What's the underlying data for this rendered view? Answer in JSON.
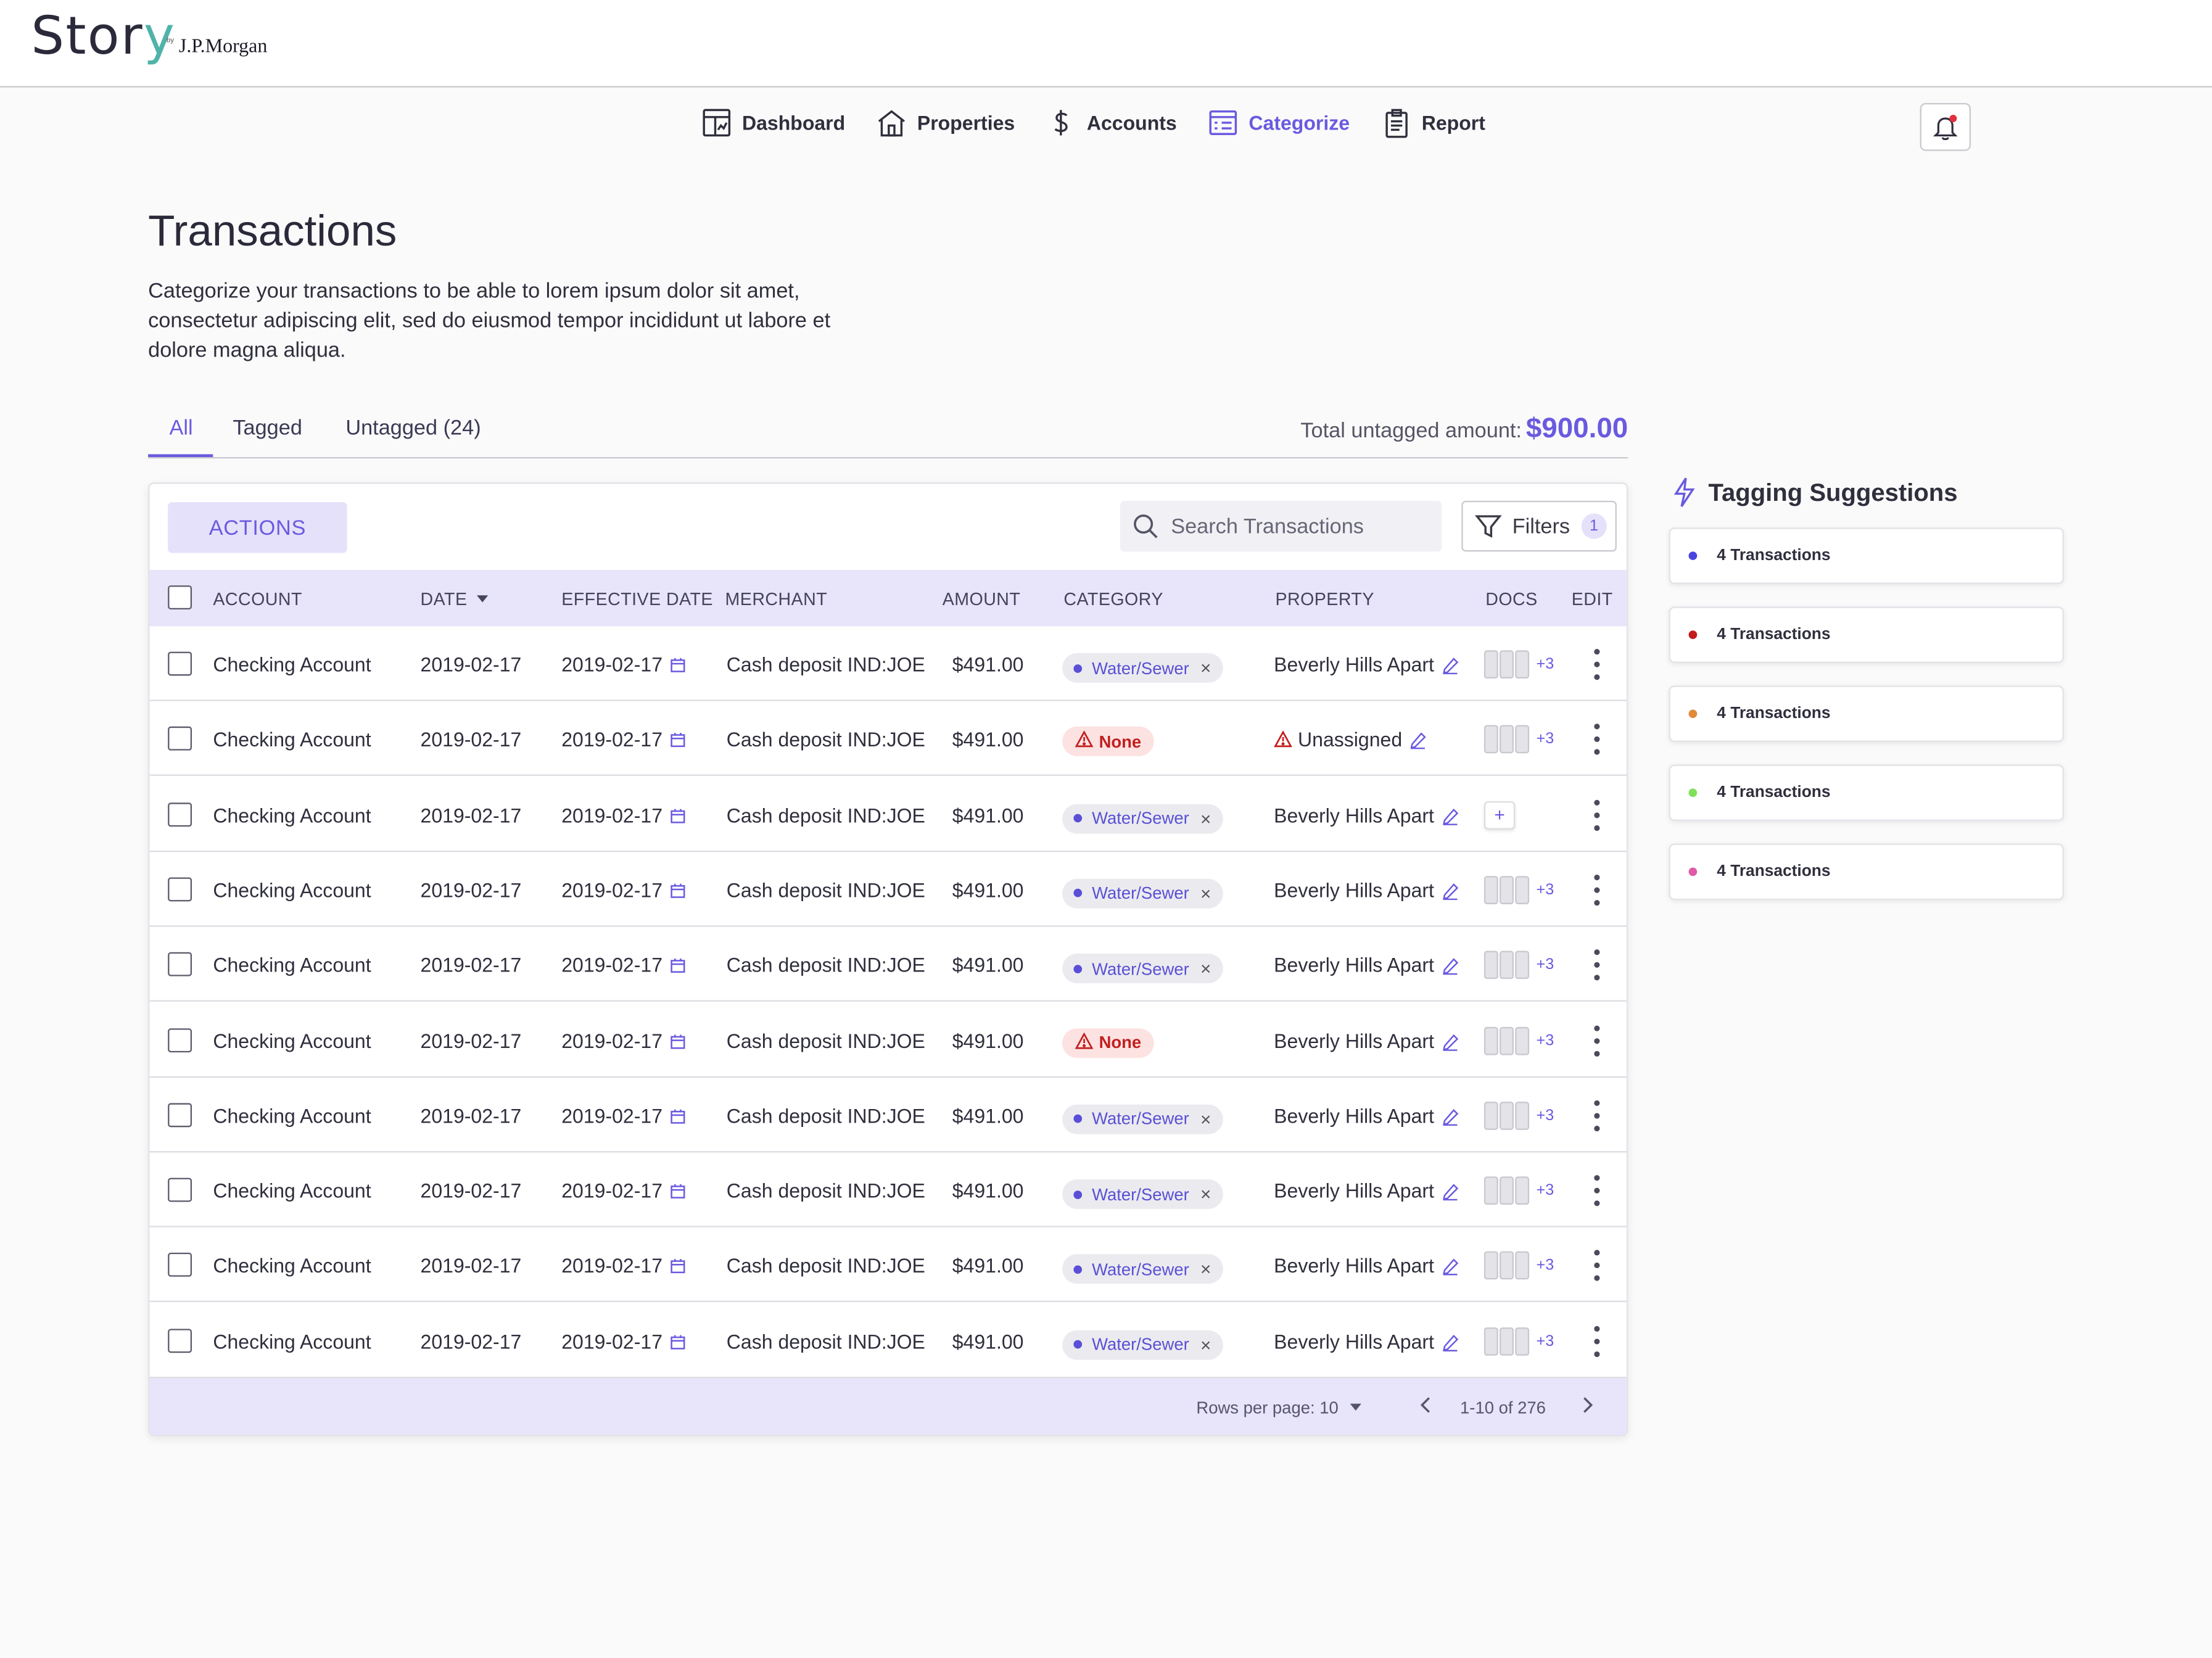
{
  "brand": {
    "name_main": "Stor",
    "name_y": "y",
    "by": "by",
    "partner": "J.P.Morgan"
  },
  "nav": [
    {
      "label": "Dashboard",
      "icon": "dashboard-icon"
    },
    {
      "label": "Properties",
      "icon": "house-icon"
    },
    {
      "label": "Accounts",
      "icon": "dollar-icon"
    },
    {
      "label": "Categorize",
      "icon": "categorize-icon",
      "active": true
    },
    {
      "label": "Report",
      "icon": "clipboard-icon"
    }
  ],
  "page": {
    "title": "Transactions",
    "description": "Categorize your transactions to be able to lorem ipsum dolor sit amet, consectetur adipiscing elit, sed do eiusmod tempor incididunt ut labore et dolore magna aliqua."
  },
  "tabs": {
    "all": "All",
    "tagged": "Tagged",
    "untagged": "Untagged (24)"
  },
  "total": {
    "label": "Total untagged amount:",
    "amount": "$900.00"
  },
  "toolbar": {
    "actions_label": "ACTIONS",
    "search_placeholder": "Search Transactions",
    "filters_label": "Filters",
    "filters_count": "1"
  },
  "columns": {
    "account": "ACCOUNT",
    "date": "DATE",
    "effective_date": "EFFECTIVE DATE",
    "merchant": "MERCHANT",
    "amount": "AMOUNT",
    "category": "CATEGORY",
    "property": "PROPERTY",
    "docs": "DOCS",
    "edit": "EDIT"
  },
  "rows": [
    {
      "account": "Checking Account",
      "date": "2019-02-17",
      "effective_date": "2019-02-17",
      "merchant": "Cash deposit IND:JOE",
      "amount": "$491.00",
      "category": "Water/Sewer",
      "category_state": "tagged",
      "property": "Beverly Hills Apart",
      "property_state": "assigned",
      "docs": "+3"
    },
    {
      "account": "Checking Account",
      "date": "2019-02-17",
      "effective_date": "2019-02-17",
      "merchant": "Cash deposit IND:JOE",
      "amount": "$491.00",
      "category": "None",
      "category_state": "none",
      "property": "Unassigned",
      "property_state": "unassigned",
      "docs": "+3"
    },
    {
      "account": "Checking Account",
      "date": "2019-02-17",
      "effective_date": "2019-02-17",
      "merchant": "Cash deposit IND:JOE",
      "amount": "$491.00",
      "category": "Water/Sewer",
      "category_state": "tagged",
      "property": "Beverly Hills Apart",
      "property_state": "assigned",
      "docs": "+"
    },
    {
      "account": "Checking Account",
      "date": "2019-02-17",
      "effective_date": "2019-02-17",
      "merchant": "Cash deposit IND:JOE",
      "amount": "$491.00",
      "category": "Water/Sewer",
      "category_state": "tagged",
      "property": "Beverly Hills Apart",
      "property_state": "assigned",
      "docs": "+3"
    },
    {
      "account": "Checking Account",
      "date": "2019-02-17",
      "effective_date": "2019-02-17",
      "merchant": "Cash deposit IND:JOE",
      "amount": "$491.00",
      "category": "Water/Sewer",
      "category_state": "tagged",
      "property": "Beverly Hills Apart",
      "property_state": "assigned",
      "docs": "+3"
    },
    {
      "account": "Checking Account",
      "date": "2019-02-17",
      "effective_date": "2019-02-17",
      "merchant": "Cash deposit IND:JOE",
      "amount": "$491.00",
      "category": "None",
      "category_state": "none",
      "property": "Beverly Hills Apart",
      "property_state": "assigned",
      "docs": "+3"
    },
    {
      "account": "Checking Account",
      "date": "2019-02-17",
      "effective_date": "2019-02-17",
      "merchant": "Cash deposit IND:JOE",
      "amount": "$491.00",
      "category": "Water/Sewer",
      "category_state": "tagged",
      "property": "Beverly Hills Apart",
      "property_state": "assigned",
      "docs": "+3"
    },
    {
      "account": "Checking Account",
      "date": "2019-02-17",
      "effective_date": "2019-02-17",
      "merchant": "Cash deposit IND:JOE",
      "amount": "$491.00",
      "category": "Water/Sewer",
      "category_state": "tagged",
      "property": "Beverly Hills Apart",
      "property_state": "assigned",
      "docs": "+3"
    },
    {
      "account": "Checking Account",
      "date": "2019-02-17",
      "effective_date": "2019-02-17",
      "merchant": "Cash deposit IND:JOE",
      "amount": "$491.00",
      "category": "Water/Sewer",
      "category_state": "tagged",
      "property": "Beverly Hills Apart",
      "property_state": "assigned",
      "docs": "+3"
    },
    {
      "account": "Checking Account",
      "date": "2019-02-17",
      "effective_date": "2019-02-17",
      "merchant": "Cash deposit IND:JOE",
      "amount": "$491.00",
      "category": "Water/Sewer",
      "category_state": "tagged",
      "property": "Beverly Hills Apart",
      "property_state": "assigned",
      "docs": "+3"
    }
  ],
  "pagination": {
    "rows_per_page_label": "Rows per page: 10",
    "range": "1-10 of 276"
  },
  "suggestions": {
    "title": "Tagging Suggestions",
    "items": [
      {
        "label": "4 Transactions",
        "color": "#4a44e0"
      },
      {
        "label": "4 Transactions",
        "color": "#c21d1d"
      },
      {
        "label": "4 Transactions",
        "color": "#e08a3a"
      },
      {
        "label": "4 Transactions",
        "color": "#7fe05a"
      },
      {
        "label": "4 Transactions",
        "color": "#e05aa8"
      }
    ]
  },
  "colors": {
    "accent": "#6a5ae0",
    "header_bg": "#e8e4fa",
    "danger": "#c31f1f"
  }
}
